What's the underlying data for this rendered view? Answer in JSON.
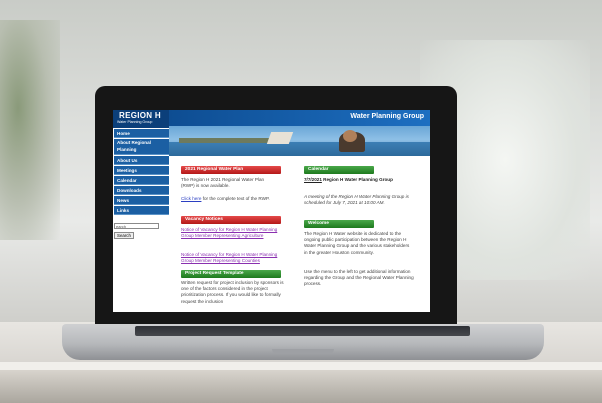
{
  "site": {
    "logo": {
      "title": "REGION H",
      "subtitle": "Water Planning Group"
    },
    "title": "Water Planning Group",
    "nav": [
      {
        "label": "Home"
      },
      {
        "label": "About Regional Planning"
      },
      {
        "label": "About Us"
      },
      {
        "label": "Meetings"
      },
      {
        "label": "Calendar"
      },
      {
        "label": "Downloads"
      },
      {
        "label": "News"
      },
      {
        "label": "Links"
      }
    ],
    "search": {
      "value": "earch",
      "button": "Search"
    },
    "plan": {
      "header": "2021 Regional Water Plan",
      "text_1": "The Region H 2021 Regional Water Plan (RWP) is now available.",
      "link": "Click here",
      "text_2": " for the complete text of the RWP."
    },
    "vacancy": {
      "header": "Vacancy Notices",
      "links": [
        "Notice of Vacancy for Region H Water Planning Group Member Representing Agriculture",
        "Notice of Vacancy for Region H Water Planning Group Member Representing Counties"
      ]
    },
    "project": {
      "header": "Project Request Template",
      "text": "Written request for project inclusion by sponsors is one of the factors considered in the project prioritization process. If you would like to formally request the inclusion"
    },
    "calendar": {
      "header": "Calendar",
      "date_link": "7/7/2021",
      "event_title": " Region H Water Planning Group",
      "event_detail": "A meeting of the Region H Water Planning Group is scheduled for July 7, 2021 at 10:00 AM."
    },
    "welcome": {
      "header": "Welcome",
      "text_1": "The Region H Water website is dedicated to the ongoing public participation between the Region H Water Planning Group and the various stakeholders in the greater Houston community.",
      "text_2": "Use the menu to the left to get additional information regarding the Group and the Regional Water Planning process."
    }
  }
}
